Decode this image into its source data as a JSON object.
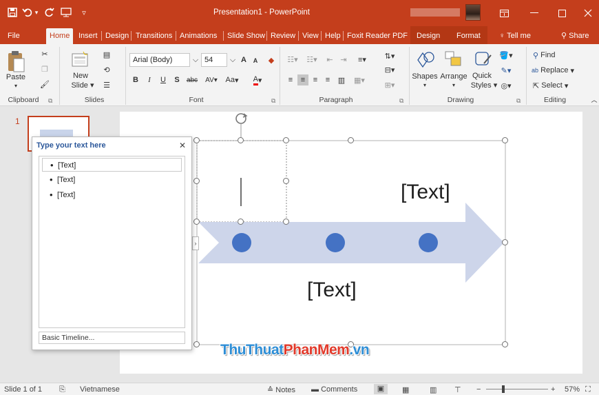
{
  "titlebar": {
    "document_title": "Presentation1 - PowerPoint",
    "qat": [
      "save-icon",
      "undo-icon",
      "redo-icon",
      "start-from-beginning-icon",
      "customize-qat-icon"
    ],
    "window_buttons": [
      "ribbon-display-options-icon",
      "minimize-icon",
      "maximize-icon",
      "close-icon"
    ]
  },
  "tabs": [
    "File",
    "Home",
    "Insert",
    "Design",
    "Transitions",
    "Animations",
    "Slide Show",
    "Review",
    "View",
    "Help",
    "Foxit Reader PDF",
    "Design",
    "Format"
  ],
  "tell_me": "Tell me",
  "share": "Share",
  "ribbon": {
    "clipboard": {
      "paste": "Paste",
      "label": "Clipboard"
    },
    "slides": {
      "new_slide": "New",
      "new_slide_2": "Slide",
      "label": "Slides"
    },
    "font": {
      "font_name": "Arial (Body)",
      "font_size": "54",
      "label": "Font",
      "bold": "B",
      "italic": "I",
      "underline": "U",
      "shadow": "S",
      "strike": "abc",
      "spacing": "AV",
      "case": "Aa",
      "color": "A",
      "grow": "A",
      "shrink": "A"
    },
    "paragraph": {
      "label": "Paragraph"
    },
    "drawing": {
      "shapes": "Shapes",
      "arrange": "Arrange",
      "quick": "Quick",
      "styles": "Styles",
      "label": "Drawing"
    },
    "editing": {
      "find": "Find",
      "replace": "Replace",
      "select": "Select",
      "label": "Editing"
    }
  },
  "thumbnail": {
    "number": "1"
  },
  "text_pane": {
    "title": "Type your text here",
    "items": [
      "[Text]",
      "[Text]",
      "[Text]"
    ],
    "footer": "Basic Timeline..."
  },
  "slide": {
    "text_top": "[Text]",
    "text_bottom": "[Text]",
    "arrow_color": "#cdd5ea",
    "dot_color": "#4472c4"
  },
  "watermark": {
    "part1": "ThuThuat",
    "part2": "PhanMem",
    "part3": ".vn"
  },
  "statusbar": {
    "slide_info": "Slide 1 of 1",
    "language": "Vietnamese",
    "notes": "Notes",
    "comments": "Comments",
    "zoom": "57%",
    "zoom_minus": "−",
    "zoom_plus": "+"
  },
  "colors": {
    "accent": "#c43e1c",
    "ribbon_bg": "#f3f3f3",
    "pane_title": "#2b579a"
  }
}
